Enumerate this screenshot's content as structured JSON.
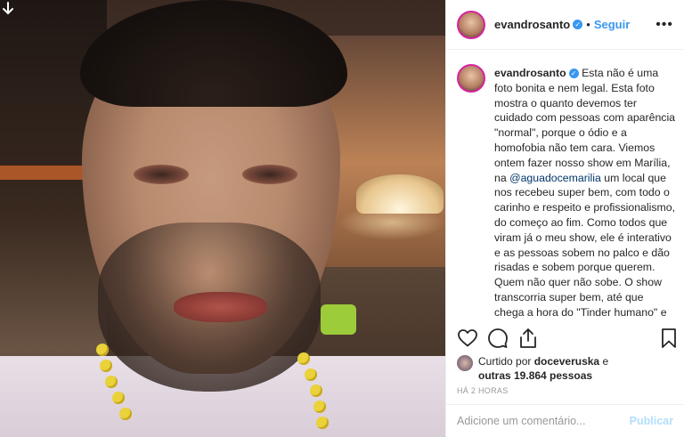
{
  "post": {
    "username": "evandrosanto",
    "verified_mark": "✓",
    "separator": "•",
    "follow_label": "Seguir",
    "more_icon": "•••",
    "caption_username": "evandrosanto",
    "caption_part1": "Esta não é uma foto bonita e nem legal. Esta foto mostra o quanto devemos ter cuidado com pessoas com aparência \"normal\", porque o ódio e a homofobia não tem cara. Viemos ontem fazer nosso show em Marília, na ",
    "caption_mention": "@aguadocemarilia",
    "caption_part2": " um local que nos recebeu super bem, com todo o carinho e respeito e profissionalismo, do começo ao fim. Como todos que viram já o meu show, ele é interativo e as pessoas sobem no palco e dão risadas e sobem porque querem. Quem não quer não sobe. O show transcorria super bem, até que chega a hora do \"Tinder humano\" e todos os meus amigos da comédia sabe que funciona. Quando pedi um rapaz solteiro, na hora um rapaz",
    "liked_prefix": "Curtido por",
    "liked_by": "doceveruska",
    "liked_and": "e",
    "liked_others": "outras 19.864 pessoas",
    "timestamp": "HÁ 2 HORAS",
    "comment_placeholder": "Adicione um comentário...",
    "publish_label": "Publicar"
  },
  "icons": {
    "download": "download-arrow-icon",
    "like": "heart-icon",
    "comment": "comment-icon",
    "share": "share-icon",
    "save": "bookmark-icon"
  },
  "colors": {
    "link_blue": "#3897f0",
    "mention": "#003569",
    "text": "#262626",
    "muted": "#999999",
    "publish_disabled": "#b2dffc"
  }
}
